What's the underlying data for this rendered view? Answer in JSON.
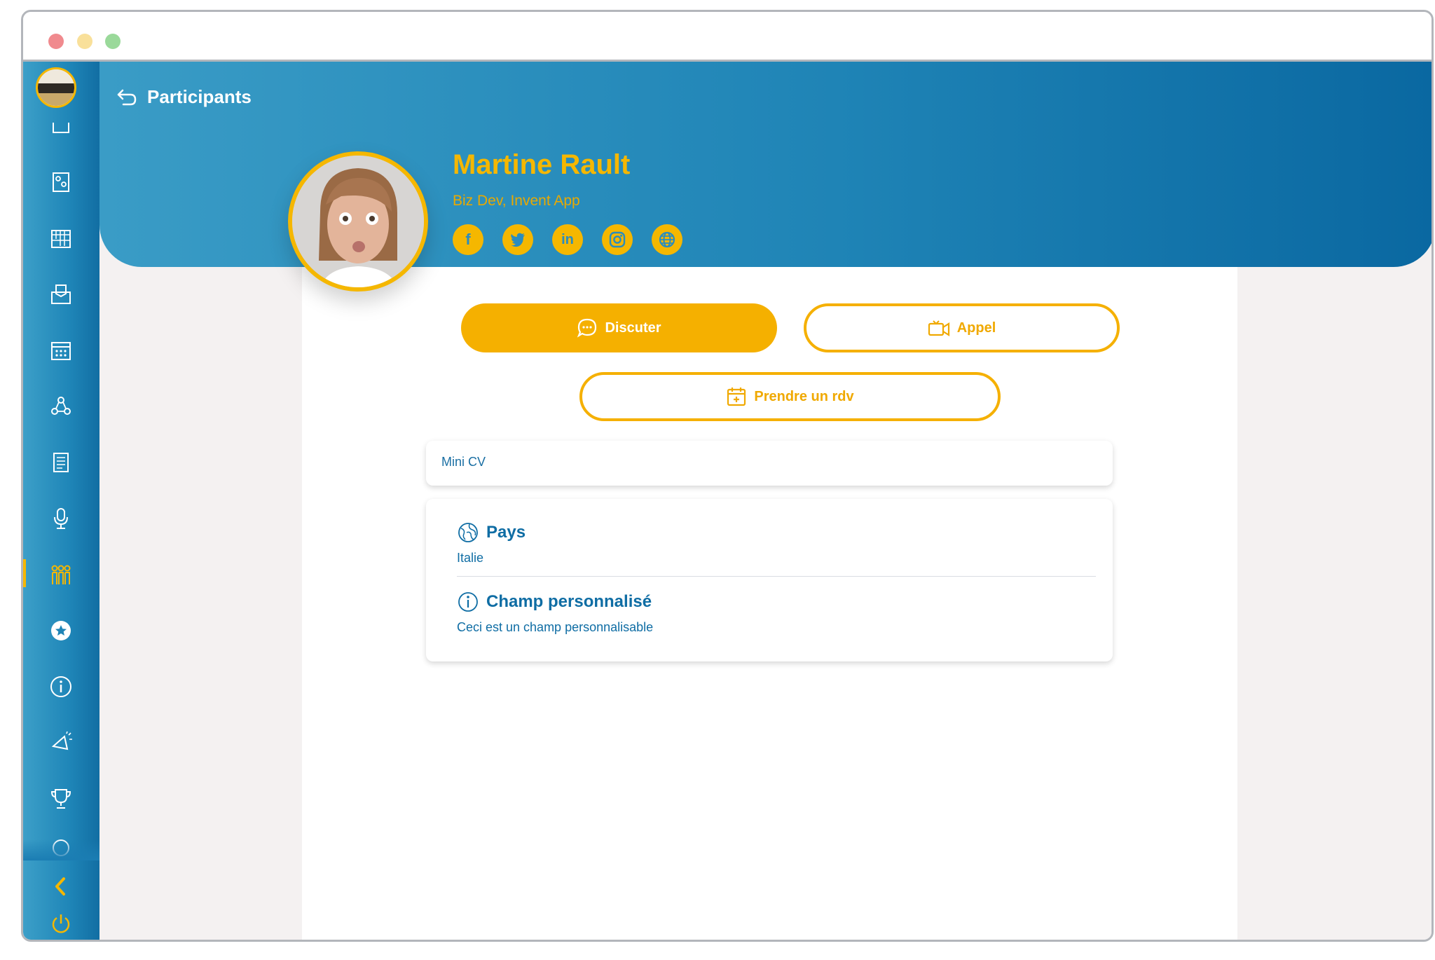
{
  "header": {
    "back_label": "Participants"
  },
  "profile": {
    "name": "Martine Rault",
    "role": "Biz Dev, Invent App",
    "socials": [
      "facebook-icon",
      "twitter-icon",
      "linkedin-icon",
      "instagram-icon",
      "globe-icon"
    ]
  },
  "actions": {
    "chat": "Discuter",
    "call": "Appel",
    "meeting": "Prendre un rdv"
  },
  "mini_cv": {
    "label": "Mini CV"
  },
  "fields": [
    {
      "title": "Pays",
      "value": "Italie",
      "icon": "globe-icon"
    },
    {
      "title": "Champ personnalisé",
      "value": "Ceci est un champ personnalisable",
      "icon": "info-icon"
    }
  ],
  "sidebar": {
    "items": [
      "home-icon",
      "map-icon",
      "calendar-icon",
      "inbox-icon",
      "schedule-icon",
      "network-icon",
      "document-icon",
      "microphone-icon",
      "participants-icon",
      "favorite-icon",
      "info-icon",
      "megaphone-icon",
      "trophy-icon",
      "more-icon"
    ],
    "active": "participants-icon"
  },
  "colors": {
    "accent": "#f5b000",
    "primary_blue": "#1f84b6",
    "dark_blue": "#0f6da4"
  }
}
